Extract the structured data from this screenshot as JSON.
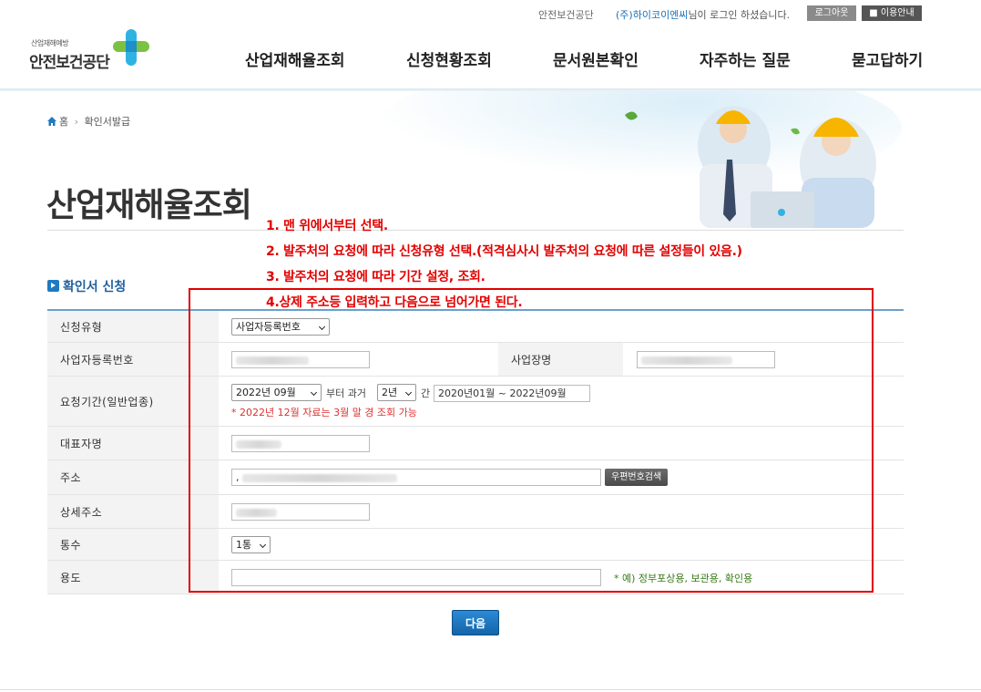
{
  "topbar": {
    "org": "안전보건공단",
    "user": "(주)하이코이엔씨",
    "user_suffix": "님이 로그인 하셨습니다.",
    "logout": "로그아웃",
    "guide": "이용안내"
  },
  "logo": {
    "small": "산업재해예방",
    "big": "안전보건공단"
  },
  "nav": [
    "산업재해율조회",
    "신청현황조회",
    "문서원본확인",
    "자주하는 질문",
    "묻고답하기"
  ],
  "breadcrumb": {
    "home": "홈",
    "current": "확인서발급"
  },
  "page_title": "산업재해율조회",
  "notes": [
    "1. 맨 위에서부터 선택.",
    "2. 발주처의 요청에 따라 신청유형 선택.(적격심사시 발주처의 요청에 따른 설정들이 있음.)",
    "3. 발주처의 요청에 따라 기간 설정, 조회.",
    "4.상제 주소등 입력하고 다음으로 넘어가면 된다."
  ],
  "section_title": "확인서 신청",
  "form": {
    "type_label": "신청유형",
    "type_value": "사업자등록번호",
    "bizno_label": "사업자등록번호",
    "bizname_label": "사업장명",
    "period_label": "요청기간(일반업종)",
    "period_month": "2022년 09월",
    "period_from": "부터 과거",
    "period_years": "2년",
    "period_gan": "간",
    "period_range": "2020년01월 ~ 2022년09월",
    "period_hint": "* 2022년 12월 자료는 3월 말 경 조회 가능",
    "ceo_label": "대표자명",
    "addr_label": "주소",
    "addr_prefix": ",",
    "zip_button": "우편번호검색",
    "detail_label": "상세주소",
    "copies_label": "통수",
    "copies_value": "1통",
    "purpose_label": "용도",
    "purpose_hint": "* 예) 정부포상용, 보관용, 확인용"
  },
  "next_button": "다음",
  "colors": {
    "accent": "#1f7ac0",
    "annotation": "#e30000",
    "hint_red": "#e03030",
    "hint_green": "#3a7a1a"
  }
}
